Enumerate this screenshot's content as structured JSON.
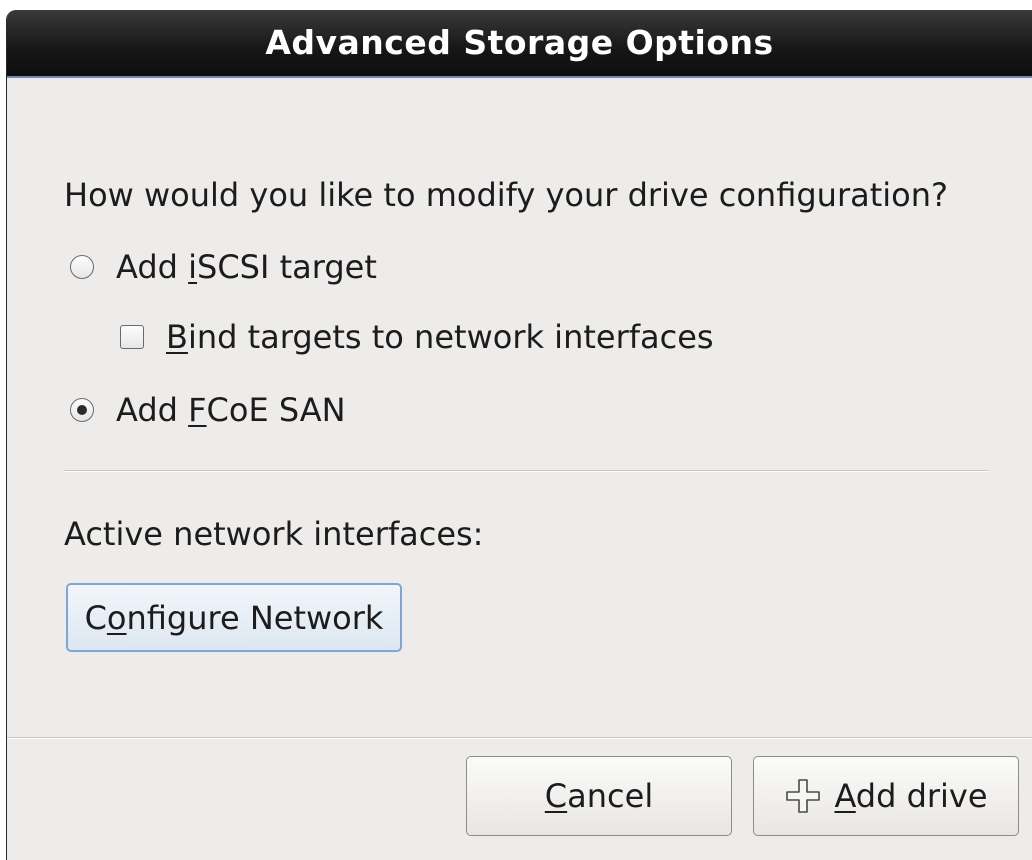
{
  "dialog": {
    "title": "Advanced Storage Options",
    "question": "How would you like to modify your drive configuration?",
    "options": {
      "iscsi": {
        "label_pre": "Add ",
        "mnemonic": "i",
        "label_post": "SCSI target",
        "selected": false
      },
      "bind": {
        "label_pre": "",
        "mnemonic": "B",
        "label_post": "ind targets to network interfaces",
        "checked": false
      },
      "fcoe": {
        "label_pre": "Add ",
        "mnemonic": "F",
        "label_post": "CoE SAN",
        "selected": true
      }
    },
    "network_label": "Active network interfaces:",
    "configure_button": {
      "pre": "C",
      "mnemonic": "o",
      "post": "nfigure Network"
    },
    "cancel_button": {
      "pre": "",
      "mnemonic": "C",
      "post": "ancel"
    },
    "add_button": {
      "pre": "",
      "mnemonic": "A",
      "post": "dd drive",
      "icon": "plus-icon"
    }
  }
}
